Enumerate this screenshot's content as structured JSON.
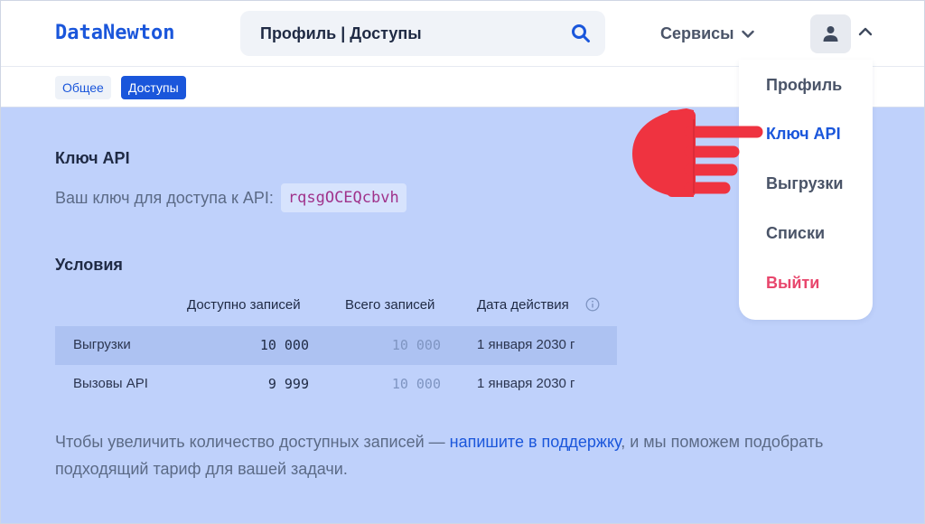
{
  "header": {
    "logo": "DataNewton",
    "search_value": "Профиль | Доступы",
    "services_label": "Сервисы"
  },
  "subnav": {
    "tabs": [
      {
        "label": "Общее",
        "active": false
      },
      {
        "label": "Доступы",
        "active": true
      }
    ]
  },
  "api_key": {
    "heading": "Ключ API",
    "label": "Ваш ключ для доступа к API:",
    "value": "rqsgOCEQcbvh"
  },
  "conditions": {
    "heading": "Условия",
    "columns": [
      "Доступно записей",
      "Всего записей",
      "Дата действия"
    ],
    "rows": [
      {
        "name": "Выгрузки",
        "available": "10 000",
        "total": "10 000",
        "date": "1 января 2030 г"
      },
      {
        "name": "Вызовы API",
        "available": "9 999",
        "total": "10 000",
        "date": "1 января 2030 г"
      }
    ]
  },
  "footer": {
    "text_before": "Чтобы увеличить количество доступных записей — ",
    "link": "напишите в поддержку",
    "text_after": ", и мы поможем подобрать подходящий тариф для вашей задачи."
  },
  "menu": {
    "items": [
      "Профиль",
      "Ключ API",
      "Выгрузки",
      "Списки",
      "Выйти"
    ]
  },
  "colors": {
    "accent": "#1a56db",
    "background": "#bfd1fb",
    "danger": "#e8466c",
    "hand": "#ef3340"
  },
  "icons": [
    "search-icon",
    "chevron-down-icon",
    "user-icon",
    "chevron-up-icon",
    "info-icon",
    "pointing-hand-icon"
  ]
}
